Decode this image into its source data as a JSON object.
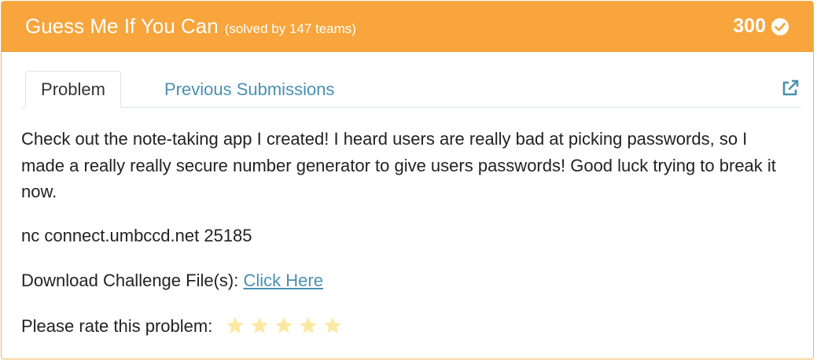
{
  "header": {
    "title": "Guess Me If You Can",
    "solved": "(solved by 147 teams)",
    "points": "300",
    "icon": "check-circle-icon"
  },
  "tabs": [
    {
      "label": "Problem",
      "active": true
    },
    {
      "label": "Previous Submissions",
      "active": false
    }
  ],
  "external_link_icon": "external-link-icon",
  "body": {
    "description": "Check out the note-taking app I created! I heard users are really bad at picking passwords, so I made a really really secure number generator to give users passwords! Good luck trying to break it now.",
    "connection": "nc connect.umbccd.net 25185",
    "download_label": "Download Challenge File(s): ",
    "download_link": "Click Here",
    "rate_label": "Please rate this problem:",
    "rating": 0,
    "rating_max": 5
  },
  "colors": {
    "header_bg": "#f7a53c",
    "link": "#4a90b0",
    "star": "#fbe9a3"
  }
}
